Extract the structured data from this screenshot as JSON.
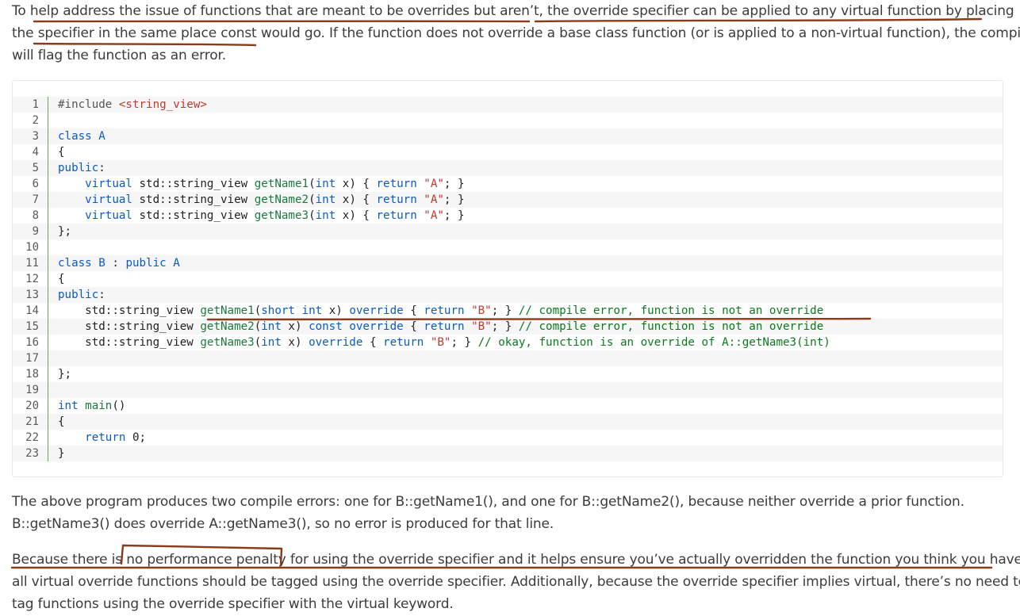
{
  "paragraph1": {
    "line1": "To help address the issue of functions that are meant to be overrides but aren’t, the override specifier can be applied to any virtual function by placing",
    "line2": "the specifier in the same place const would go. If the function does not override a base class function (or is applied to a non-virtual function), the compiler",
    "line3": "will flag the function as an error."
  },
  "code": {
    "lines": [
      {
        "n": "1",
        "text": "#include <string_view>"
      },
      {
        "n": "2",
        "text": ""
      },
      {
        "n": "3",
        "text": "class A"
      },
      {
        "n": "4",
        "text": "{"
      },
      {
        "n": "5",
        "text": "public:"
      },
      {
        "n": "6",
        "text": "    virtual std::string_view getName1(int x) { return \"A\"; }"
      },
      {
        "n": "7",
        "text": "    virtual std::string_view getName2(int x) { return \"A\"; }"
      },
      {
        "n": "8",
        "text": "    virtual std::string_view getName3(int x) { return \"A\"; }"
      },
      {
        "n": "9",
        "text": "};"
      },
      {
        "n": "10",
        "text": ""
      },
      {
        "n": "11",
        "text": "class B : public A"
      },
      {
        "n": "12",
        "text": "{"
      },
      {
        "n": "13",
        "text": "public:"
      },
      {
        "n": "14",
        "text": "    std::string_view getName1(short int x) override { return \"B\"; } // compile error, function is not an override"
      },
      {
        "n": "15",
        "text": "    std::string_view getName2(int x) const override { return \"B\"; } // compile error, function is not an override"
      },
      {
        "n": "16",
        "text": "    std::string_view getName3(int x) override { return \"B\"; } // okay, function is an override of A::getName3(int)"
      },
      {
        "n": "17",
        "text": ""
      },
      {
        "n": "18",
        "text": "};"
      },
      {
        "n": "19",
        "text": ""
      },
      {
        "n": "20",
        "text": "int main()"
      },
      {
        "n": "21",
        "text": "{"
      },
      {
        "n": "22",
        "text": "    return 0;"
      },
      {
        "n": "23",
        "text": "}"
      }
    ]
  },
  "paragraph2": {
    "line1": "The above program produces two compile errors: one for B::getName1(), and one for B::getName2(), because neither override a prior function.",
    "line2": "B::getName3() does override A::getName3(), so no error is produced for that line."
  },
  "paragraph3": {
    "line1": "Because there is no performance penalty for using the override specifier and it helps ensure you’ve actually overridden the function you think you have,",
    "line2": "all virtual override functions should be tagged using the override specifier. Additionally, because the override specifier implies virtual, there’s no need to",
    "line3": "tag functions using the override specifier with the virtual keyword."
  },
  "colors": {
    "keyword": "#0a5bc4",
    "string": "#c0392b",
    "comment": "#0a7a1f",
    "annotation_ink": "#8b3a1a"
  }
}
